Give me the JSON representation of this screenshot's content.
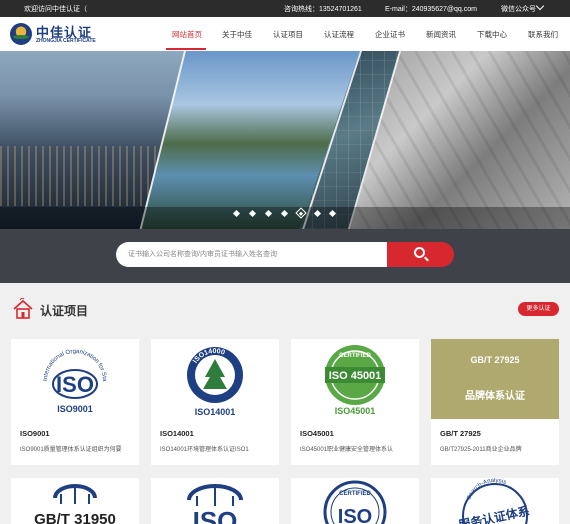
{
  "topbar": {
    "welcome": "欢迎访问中佳认证（",
    "hotline": "咨询热线：13524701261",
    "email": "E-mail：240935627@qq.com",
    "wechat": "微信公众号"
  },
  "header": {
    "logo_cn": "中佳认证",
    "logo_en": "ZHONGJIA CERTIFICATE",
    "nav": [
      "网站首页",
      "关于中佳",
      "认证项目",
      "认证流程",
      "企业证书",
      "新闻资讯",
      "下载中心",
      "联系我们"
    ],
    "active_nav": 0
  },
  "banner": {
    "slide_count": 7,
    "active_slide": 4
  },
  "search": {
    "placeholder": "证书输入公司名称查询/内审员证书输入姓名查询"
  },
  "section": {
    "title": "认证项目",
    "more_label": "更多认证"
  },
  "cards": [
    {
      "logo_text": "ISO",
      "logo_sub": "ISO9001",
      "logo_ring": "International Organization for Standardization",
      "title": "ISO9001",
      "desc": "ISO9001质量管理体系认证组织为何要"
    },
    {
      "logo_text": "ISO",
      "logo_sub": "ISO14001",
      "logo_ring": "ISO14000",
      "title": "ISO14001",
      "desc": "ISO14001环境管理体系认证ISO1"
    },
    {
      "logo_text": "ISO 45001",
      "logo_sub": "ISO45001",
      "logo_ring": "CERTIFIED",
      "title": "ISO45001",
      "desc": "ISO45001职业健康安全管理体系认"
    },
    {
      "logo_text": "GB/T 27925",
      "logo_sub": "品牌体系认证",
      "title": "GB/T 27925",
      "desc": "GB/T27925-2011商业企业品牌"
    }
  ],
  "cards_row2": [
    {
      "logo_text": "GB/T 31950"
    },
    {
      "logo_text": "ISO"
    },
    {
      "logo_text": "ISO",
      "logo_ring": "CERTIFIED"
    },
    {
      "logo_text": "服务认证体系",
      "logo_ring": "Search-Analysis"
    }
  ],
  "colors": {
    "accent": "#d7282f",
    "brand": "#1e3f82",
    "topbar": "#2c2c2c",
    "search_band": "#404249"
  }
}
